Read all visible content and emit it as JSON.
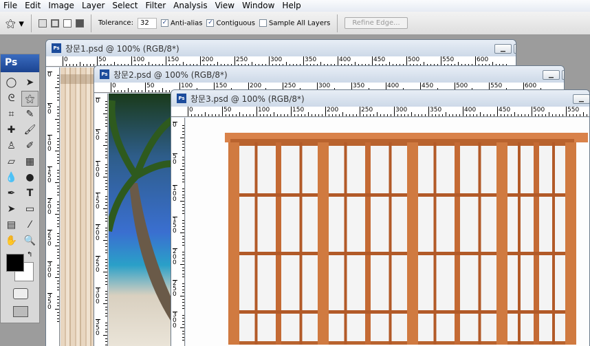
{
  "menu": [
    "File",
    "Edit",
    "Image",
    "Layer",
    "Select",
    "Filter",
    "Analysis",
    "View",
    "Window",
    "Help"
  ],
  "options": {
    "tolerance_label": "Tolerance:",
    "tolerance_value": "32",
    "anti_alias": "Anti-alias",
    "anti_alias_checked": true,
    "contiguous": "Contiguous",
    "contiguous_checked": true,
    "sample_all": "Sample All Layers",
    "sample_all_checked": false,
    "refine_edge": "Refine Edge..."
  },
  "toolbox": {
    "logo": "Ps"
  },
  "documents": [
    {
      "title": "창문1.psd @ 100% (RGB/8*)",
      "icon": "Ps",
      "ruler_labels": [
        "0",
        "50",
        "100",
        "150",
        "200",
        "250",
        "300",
        "350",
        "400",
        "450",
        "500",
        "550",
        "600"
      ],
      "v_labels": [
        "0",
        "50",
        "100",
        "150",
        "200",
        "250",
        "300",
        "350"
      ]
    },
    {
      "title": "창문2.psd @ 100% (RGB/8*)",
      "icon": "Ps",
      "ruler_labels": [
        "0",
        "50",
        "100",
        "150",
        "200",
        "250",
        "300",
        "350",
        "400",
        "450",
        "500",
        "550",
        "600"
      ],
      "v_labels": [
        "0",
        "50",
        "100",
        "150",
        "200",
        "250",
        "300",
        "350"
      ]
    },
    {
      "title": "창문3.psd @ 100% (RGB/8*)",
      "icon": "Ps",
      "ruler_labels": [
        "0",
        "50",
        "100",
        "150",
        "200",
        "250",
        "300",
        "350",
        "400",
        "450",
        "500",
        "550"
      ],
      "v_labels": [
        "0",
        "50",
        "100",
        "150",
        "200",
        "250",
        "300"
      ]
    }
  ]
}
